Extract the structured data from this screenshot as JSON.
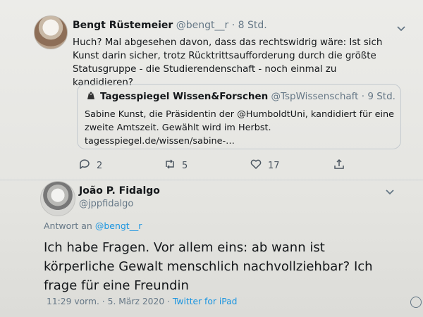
{
  "tweet1": {
    "author_name": "Bengt Rüstemeier",
    "handle": "@bengt__r",
    "separator": "·",
    "time": "8 Std.",
    "text": "Huch? Mal abgesehen davon, dass das rechtswidrig wäre: Ist sich Kunst darin sicher, trotz Rücktrittsaufforderung durch die größte Statusgruppe - die Studierendenschaft - noch einmal zu kandidieren?",
    "quote": {
      "author_name": "Tagesspiegel Wissen&Forschen",
      "handle": "@TspWissenschaft",
      "separator": "·",
      "time": "9 Std.",
      "text": "Sabine Kunst, die Präsidentin der @HumboldtUni, kandidiert für eine zweite Amtszeit. Gewählt wird im Herbst. tagesspiegel.de/wissen/sabine-…"
    },
    "actions": {
      "reply_count": "2",
      "retweet_count": "5",
      "like_count": "17"
    }
  },
  "tweet2": {
    "author_name": "João P. Fidalgo",
    "handle": "@jppfidalgo",
    "reply_prefix": "Antwort an",
    "reply_handle": "@bengt__r",
    "text": "Ich habe Fragen. Vor allem eins: ab wann ist körperliche Gewalt menschlich nachvollziehbar? Ich frage für eine Freundin",
    "timestamp": "11:29 vorm.",
    "separator": "·",
    "date": "5. März 2020",
    "source": "Twitter for iPad"
  },
  "colors": {
    "link": "#1b95e0",
    "muted": "#657786",
    "text": "#14171a"
  }
}
